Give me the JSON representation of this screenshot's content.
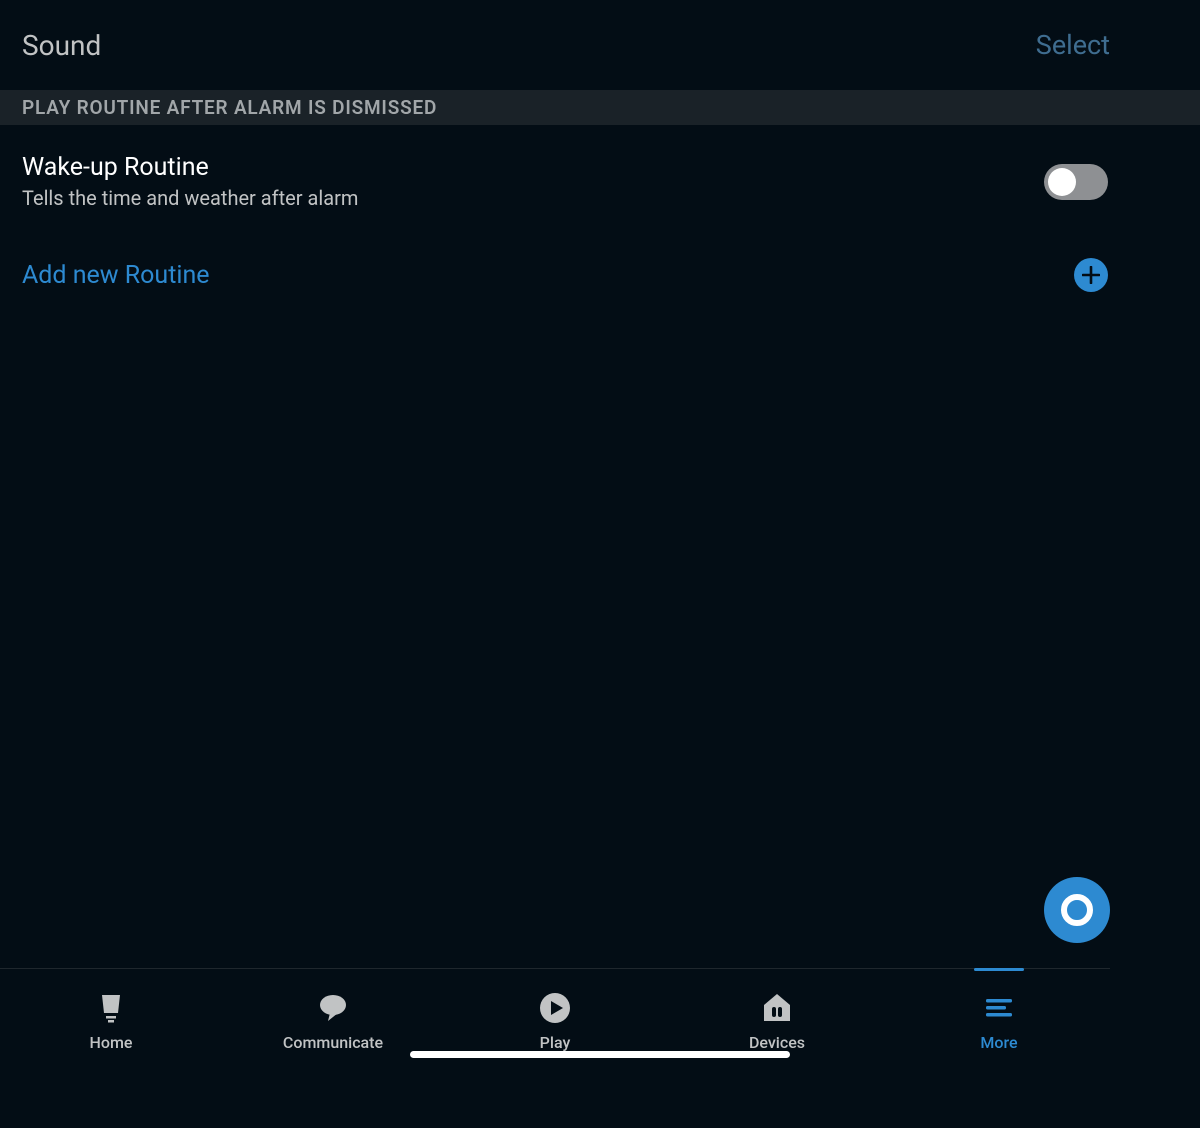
{
  "header": {
    "title": "Sound",
    "action": "Select"
  },
  "section": {
    "heading": "PLAY ROUTINE AFTER ALARM IS DISMISSED"
  },
  "routine": {
    "title": "Wake-up Routine",
    "subtitle": "Tells the time and weather after alarm",
    "enabled": false
  },
  "add_routine": {
    "label": "Add new Routine"
  },
  "tabs": {
    "home": "Home",
    "communicate": "Communicate",
    "play": "Play",
    "devices": "Devices",
    "more": "More"
  },
  "colors": {
    "accent": "#2d8ad1",
    "bg": "#030d15"
  }
}
